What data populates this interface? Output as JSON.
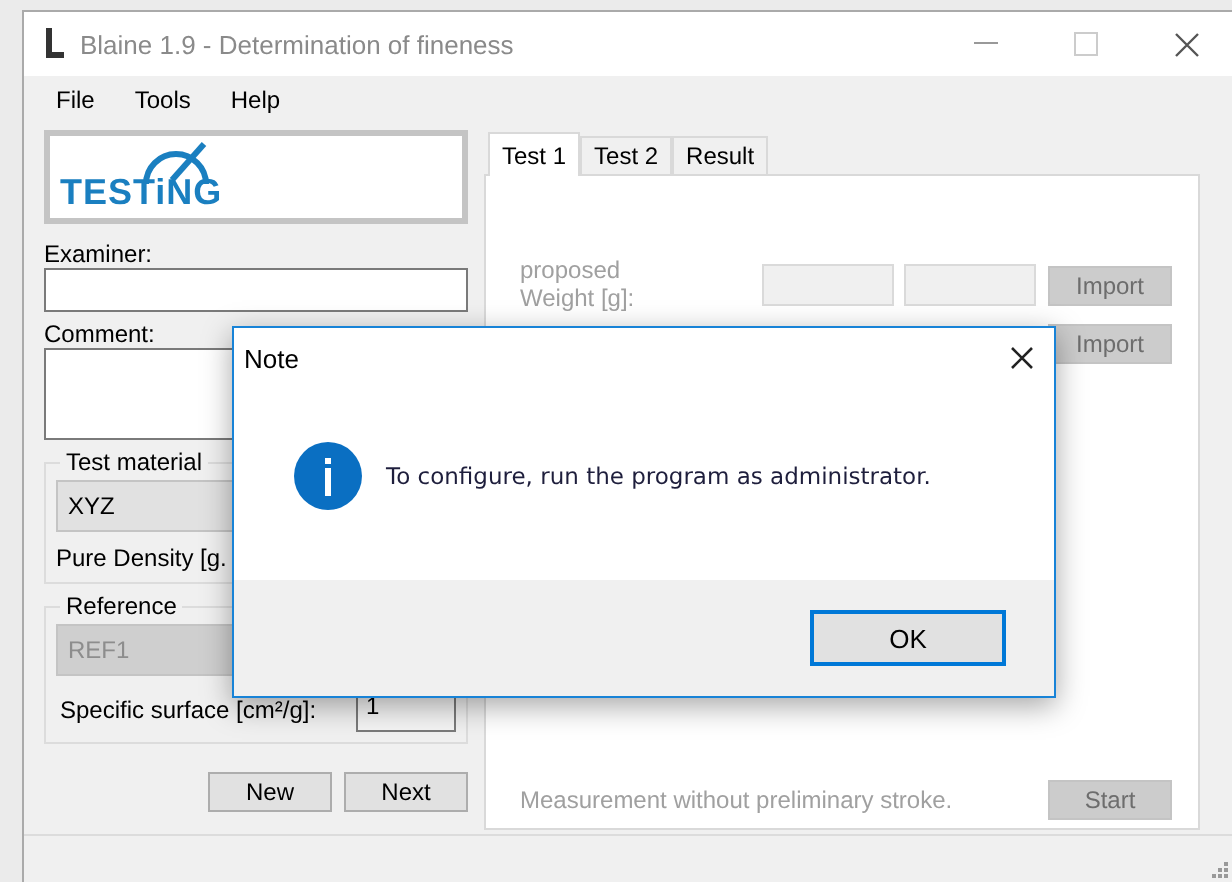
{
  "window": {
    "title": "Blaine 1.9 - Determination of fineness"
  },
  "menu": [
    "File",
    "Tools",
    "Help"
  ],
  "logo": {
    "text": "TESTiNG"
  },
  "examiner": {
    "label": "Examiner:"
  },
  "comment": {
    "label": "Comment:"
  },
  "test_material": {
    "legend": "Test material",
    "value": "XYZ",
    "density_label": "Pure Density [g."
  },
  "reference": {
    "legend": "Reference",
    "value": "REF1",
    "disabled": true,
    "surface_label": "Specific surface [cm²/g]:",
    "surface_value": "1"
  },
  "buttons": [
    "New",
    "Next"
  ],
  "tabs": [
    {
      "label": "Test 1",
      "selected": true
    },
    {
      "label": "Test 2",
      "selected": false
    },
    {
      "label": "Result",
      "selected": false
    }
  ],
  "test_panel": {
    "proposed_label": "proposed",
    "weight_label": "Weight [g]:",
    "import_buttons": [
      "Import",
      "Import"
    ],
    "note": "Measurement without preliminary stroke.",
    "start": "Start"
  },
  "dialog": {
    "title": "Note",
    "message": "To configure, run the program as administrator.",
    "button": "OK"
  }
}
